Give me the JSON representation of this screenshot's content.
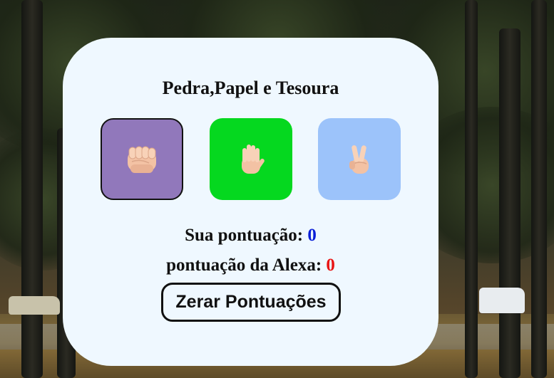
{
  "game": {
    "title": "Pedra,Papel e Tesoura"
  },
  "choices": [
    {
      "name": "rock",
      "icon": "fist-icon",
      "color": "#9178bb"
    },
    {
      "name": "paper",
      "icon": "raised-hand-icon",
      "color": "#05d81f"
    },
    {
      "name": "scissors",
      "icon": "victory-hand-icon",
      "color": "#9cc3fa"
    }
  ],
  "scores": {
    "user_label": "Sua pontuação:",
    "user_value": "0",
    "alexa_label": "pontuação da Alexa:",
    "alexa_value": "0"
  },
  "reset": {
    "label": "Zerar Pontuações"
  },
  "colors": {
    "card_background": "#eff8ff",
    "user_score": "#0a1fd8",
    "alexa_score": "#e81515"
  }
}
